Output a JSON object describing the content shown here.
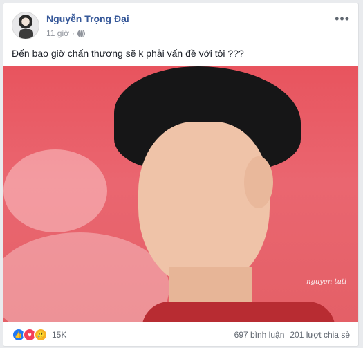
{
  "post": {
    "author": "Nguyễn Trọng Đại",
    "time": "11 giờ",
    "message": "Đến bao giờ chấn thương sẽ k phải vấn đề với tôi ???",
    "watermark": "nguyen tuti",
    "icons": {
      "more": "more-options-icon",
      "privacy": "globe-icon"
    }
  },
  "footer": {
    "reactions_count": "15K",
    "comments": "697 bình luận",
    "shares": "201 lượt chia sẻ",
    "reaction_icons": [
      "like-icon",
      "love-icon",
      "sad-icon"
    ],
    "colors": {
      "like": "#2078f4",
      "love": "#f33e58",
      "sad": "#f7b125",
      "link": "#365899"
    }
  }
}
